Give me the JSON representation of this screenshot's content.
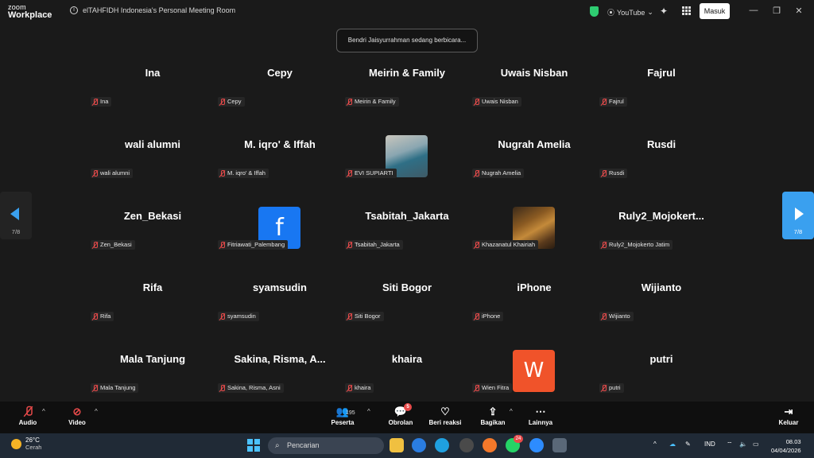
{
  "app": {
    "logo_line1": "zoom",
    "logo_line2": "Workplace",
    "meeting_title": "elTAHFIDH Indonesia's Personal Meeting Room"
  },
  "titlebar": {
    "youtube": "YouTube",
    "masuk": "Masuk"
  },
  "toast": "Bendri Jaisyurrahman sedang berbicara...",
  "pager": {
    "left": "7/8",
    "right": "7/8"
  },
  "tiles": [
    {
      "big": "Ina",
      "label": "Ina"
    },
    {
      "big": "Cepy",
      "label": "Cepy"
    },
    {
      "big": "Meirin & Family",
      "label": "Meirin & Family"
    },
    {
      "big": "Uwais Nisban",
      "label": "Uwais Nisban"
    },
    {
      "big": "Fajrul",
      "label": "Fajrul"
    },
    {
      "big": "wali alumni",
      "label": "wali alumni"
    },
    {
      "big": "M. iqro' & Iffah",
      "label": "M. iqro' & Iffah"
    },
    {
      "big": "",
      "label": "EVI SUPIARTI"
    },
    {
      "big": "Nugrah Amelia",
      "label": "Nugrah Amelia"
    },
    {
      "big": "Rusdi",
      "label": "Rusdi"
    },
    {
      "big": "Zen_Bekasi",
      "label": "Zen_Bekasi"
    },
    {
      "big": "",
      "label": "Fitriawati_Palembang",
      "avatar_letter": "f"
    },
    {
      "big": "Tsabitah_Jakarta",
      "label": "Tsabitah_Jakarta"
    },
    {
      "big": "",
      "label": "Khazanatul Khairiah"
    },
    {
      "big": "Ruly2_Mojokert...",
      "label": "Ruly2_Mojokerto Jatim"
    },
    {
      "big": "Rifa",
      "label": "Rifa"
    },
    {
      "big": "syamsudin",
      "label": "syamsudin"
    },
    {
      "big": "Siti Bogor",
      "label": "Siti Bogor"
    },
    {
      "big": "iPhone",
      "label": "iPhone"
    },
    {
      "big": "Wijianto",
      "label": "Wijianto"
    },
    {
      "big": "Mala Tanjung",
      "label": "Mala Tanjung"
    },
    {
      "big": "Sakina, Risma, A...",
      "label": "Sakina, Risma, Asni"
    },
    {
      "big": "khaira",
      "label": "khaira"
    },
    {
      "big": "",
      "label": "Wien Fitra",
      "avatar_letter": "W"
    },
    {
      "big": "putri",
      "label": "putri"
    }
  ],
  "toolbar": {
    "audio": "Audio",
    "video": "Video",
    "peserta": "Peserta",
    "peserta_count": "195",
    "obrolan": "Obrolan",
    "obrolan_badge": "5",
    "beri_reaksi": "Beri reaksi",
    "bagikan": "Bagikan",
    "lainnya": "Lainnya",
    "keluar": "Keluar"
  },
  "taskbar": {
    "temp": "26°C",
    "weather": "Cerah",
    "search": "Pencarian",
    "whatsapp_badge": "24",
    "lang": "IND",
    "time": "08.03",
    "date": "04/04/2026"
  },
  "colors": {
    "accent": "#3aa0ef",
    "muted_red": "#e84a4a",
    "fb_blue": "#1877f2",
    "w_orange": "#f0532a"
  }
}
